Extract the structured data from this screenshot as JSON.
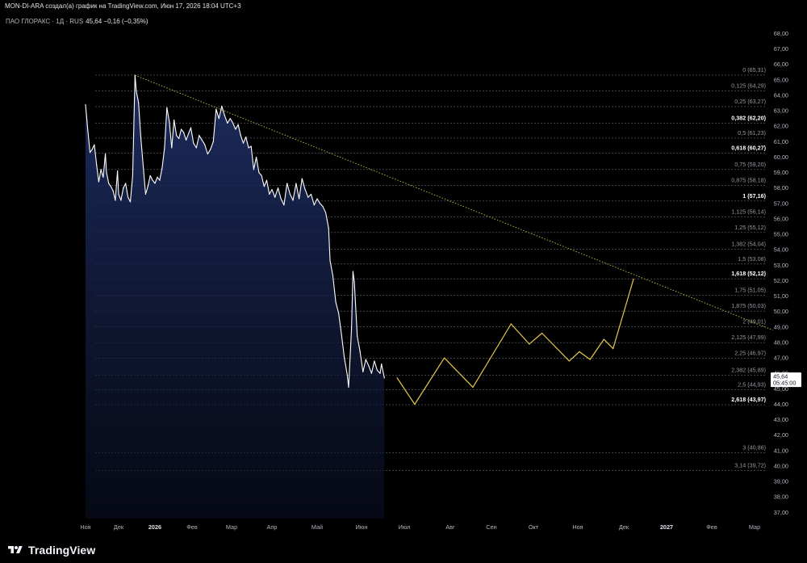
{
  "header": {
    "text": "MON-DI-ARA создал(а) график на TradingView.com, Июн 17, 2026 18:04 UTC+3"
  },
  "legend": {
    "symbol": "ПАО ГЛОРАКС · 1Д · RUS",
    "value": "45,64 −0,16 (−0,35%)"
  },
  "branding": {
    "logo_text": "TradingView",
    "logo_icon": "tradingview-logo-icon"
  },
  "price_marker": {
    "price": "45,64",
    "countdown": "05:45:00",
    "value": 45.64
  },
  "colors": {
    "background": "#000000",
    "price_line": "#ffffff",
    "area_fill_top": "#1f2f66",
    "projection": "#e6c84a",
    "trendline": "#c8c24a",
    "fib_line": "#6a6d78",
    "text": "#d1d4dc"
  },
  "chart_data": {
    "type": "area",
    "title": "ПАО ГЛОРАКС · 1Д · RUS",
    "y_axis": {
      "ylim": [
        36.6,
        68.6
      ],
      "position": "right",
      "ticks": [
        "37,00",
        "38,00",
        "39,00",
        "40,00",
        "41,00",
        "42,00",
        "43,00",
        "44,00",
        "45,00",
        "46,00",
        "47,00",
        "48,00",
        "49,00",
        "50,00",
        "51,00",
        "52,00",
        "53,00",
        "54,00",
        "55,00",
        "56,00",
        "57,00",
        "58,00",
        "59,00",
        "60,00",
        "61,00",
        "62,00",
        "63,00",
        "64,00",
        "65,00",
        "66,00",
        "67,00",
        "68,00"
      ],
      "tick_values": [
        37,
        38,
        39,
        40,
        41,
        42,
        43,
        44,
        45,
        46,
        47,
        48,
        49,
        50,
        51,
        52,
        53,
        54,
        55,
        56,
        57,
        58,
        59,
        60,
        61,
        62,
        63,
        64,
        65,
        66,
        67,
        68
      ]
    },
    "x_axis": {
      "ticks": [
        "Ноя",
        "Дек",
        "2026",
        "Фев",
        "Мар",
        "Апр",
        "Май",
        "Июн",
        "Июл",
        "Авг",
        "Сен",
        "Окт",
        "Ноя",
        "Дек",
        "2027",
        "Фев",
        "Мар"
      ],
      "tick_dates": [
        "2025-11-01",
        "2025-12-01",
        "2026-01-01",
        "2026-02-01",
        "2026-03-01",
        "2026-04-01",
        "2026-05-01",
        "2026-06-01",
        "2026-07-01",
        "2026-08-01",
        "2026-09-01",
        "2026-10-01",
        "2026-11-01",
        "2026-12-01",
        "2027-01-01",
        "2027-02-01",
        "2027-03-01"
      ],
      "bold": [
        "2026",
        "2027"
      ]
    },
    "series": [
      {
        "kind": "price",
        "points": [
          [
            "2025-11-01",
            63.4
          ],
          [
            "2025-11-03",
            61.8
          ],
          [
            "2025-11-05",
            60.3
          ],
          [
            "2025-11-07",
            60.5
          ],
          [
            "2025-11-09",
            60.8
          ],
          [
            "2025-11-11",
            59.5
          ],
          [
            "2025-11-13",
            58.4
          ],
          [
            "2025-11-15",
            59.2
          ],
          [
            "2025-11-17",
            58.7
          ],
          [
            "2025-11-19",
            60.2
          ],
          [
            "2025-11-20",
            59.0
          ],
          [
            "2025-11-22",
            58.3
          ],
          [
            "2025-11-24",
            58.1
          ],
          [
            "2025-11-26",
            57.8
          ],
          [
            "2025-11-28",
            57.2
          ],
          [
            "2025-11-30",
            59.1
          ],
          [
            "2025-12-01",
            57.6
          ],
          [
            "2025-12-03",
            57.2
          ],
          [
            "2025-12-05",
            58.0
          ],
          [
            "2025-12-07",
            58.3
          ],
          [
            "2025-12-09",
            57.4
          ],
          [
            "2025-12-11",
            57.1
          ],
          [
            "2025-12-13",
            58.8
          ],
          [
            "2025-12-15",
            65.3
          ],
          [
            "2025-12-16",
            64.3
          ],
          [
            "2025-12-18",
            63.5
          ],
          [
            "2025-12-20",
            61.2
          ],
          [
            "2025-12-22",
            59.4
          ],
          [
            "2025-12-24",
            57.6
          ],
          [
            "2025-12-26",
            58.1
          ],
          [
            "2025-12-28",
            58.8
          ],
          [
            "2025-12-30",
            58.5
          ],
          [
            "2026-01-01",
            58.3
          ],
          [
            "2026-01-03",
            58.7
          ],
          [
            "2026-01-05",
            58.5
          ],
          [
            "2026-01-07",
            59.3
          ],
          [
            "2026-01-09",
            60.6
          ],
          [
            "2026-01-11",
            63.2
          ],
          [
            "2026-01-13",
            62.3
          ],
          [
            "2026-01-15",
            60.6
          ],
          [
            "2026-01-17",
            62.4
          ],
          [
            "2026-01-19",
            61.4
          ],
          [
            "2026-01-21",
            61.2
          ],
          [
            "2026-01-23",
            61.8
          ],
          [
            "2026-01-25",
            61.6
          ],
          [
            "2026-01-27",
            61.1
          ],
          [
            "2026-01-29",
            61.5
          ],
          [
            "2026-01-31",
            61.9
          ],
          [
            "2026-02-02",
            60.9
          ],
          [
            "2026-02-04",
            60.6
          ],
          [
            "2026-02-06",
            61.4
          ],
          [
            "2026-02-08",
            61.1
          ],
          [
            "2026-02-10",
            60.8
          ],
          [
            "2026-02-12",
            60.2
          ],
          [
            "2026-02-14",
            60.5
          ],
          [
            "2026-02-16",
            61.0
          ],
          [
            "2026-02-18",
            63.1
          ],
          [
            "2026-02-20",
            62.5
          ],
          [
            "2026-02-22",
            63.3
          ],
          [
            "2026-02-24",
            62.7
          ],
          [
            "2026-02-26",
            62.2
          ],
          [
            "2026-02-28",
            62.5
          ],
          [
            "2026-03-02",
            62.2
          ],
          [
            "2026-03-04",
            61.8
          ],
          [
            "2026-03-06",
            62.1
          ],
          [
            "2026-03-08",
            61.4
          ],
          [
            "2026-03-10",
            60.9
          ],
          [
            "2026-03-12",
            61.3
          ],
          [
            "2026-03-14",
            60.6
          ],
          [
            "2026-03-16",
            60.7
          ],
          [
            "2026-03-18",
            59.2
          ],
          [
            "2026-03-20",
            60.0
          ],
          [
            "2026-03-22",
            59.0
          ],
          [
            "2026-03-24",
            58.8
          ],
          [
            "2026-03-26",
            58.1
          ],
          [
            "2026-03-28",
            58.5
          ],
          [
            "2026-03-30",
            57.6
          ],
          [
            "2026-04-01",
            57.9
          ],
          [
            "2026-04-03",
            57.4
          ],
          [
            "2026-04-05",
            58.0
          ],
          [
            "2026-04-07",
            57.3
          ],
          [
            "2026-04-09",
            56.9
          ],
          [
            "2026-04-11",
            58.3
          ],
          [
            "2026-04-13",
            57.6
          ],
          [
            "2026-04-15",
            57.2
          ],
          [
            "2026-04-17",
            58.3
          ],
          [
            "2026-04-19",
            57.3
          ],
          [
            "2026-04-21",
            58.6
          ],
          [
            "2026-04-23",
            57.9
          ],
          [
            "2026-04-25",
            57.4
          ],
          [
            "2026-04-27",
            57.6
          ],
          [
            "2026-04-29",
            56.9
          ],
          [
            "2026-05-01",
            57.3
          ],
          [
            "2026-05-03",
            57.0
          ],
          [
            "2026-05-05",
            56.8
          ],
          [
            "2026-05-07",
            56.4
          ],
          [
            "2026-05-09",
            55.4
          ],
          [
            "2026-05-10",
            53.3
          ],
          [
            "2026-05-12",
            52.3
          ],
          [
            "2026-05-14",
            50.6
          ],
          [
            "2026-05-16",
            49.9
          ],
          [
            "2026-05-18",
            48.5
          ],
          [
            "2026-05-20",
            47.0
          ],
          [
            "2026-05-22",
            45.9
          ],
          [
            "2026-05-23",
            45.1
          ],
          [
            "2026-05-25",
            48.9
          ],
          [
            "2026-05-26",
            52.6
          ],
          [
            "2026-05-27",
            51.9
          ],
          [
            "2026-05-29",
            48.4
          ],
          [
            "2026-05-31",
            47.4
          ],
          [
            "2026-06-02",
            46.1
          ],
          [
            "2026-06-04",
            46.9
          ],
          [
            "2026-06-06",
            46.5
          ],
          [
            "2026-06-08",
            46.0
          ],
          [
            "2026-06-10",
            46.8
          ],
          [
            "2026-06-12",
            46.2
          ],
          [
            "2026-06-14",
            46.0
          ],
          [
            "2026-06-15",
            46.6
          ],
          [
            "2026-06-17",
            45.7
          ]
        ]
      },
      {
        "kind": "projection",
        "points": [
          [
            "2026-06-26",
            45.7
          ],
          [
            "2026-07-08",
            44.0
          ],
          [
            "2026-07-28",
            47.0
          ],
          [
            "2026-08-18",
            45.1
          ],
          [
            "2026-09-15",
            49.2
          ],
          [
            "2026-09-28",
            47.9
          ],
          [
            "2026-10-07",
            48.6
          ],
          [
            "2026-10-26",
            46.8
          ],
          [
            "2026-11-02",
            47.4
          ],
          [
            "2026-11-09",
            46.9
          ],
          [
            "2026-11-18",
            48.2
          ],
          [
            "2026-11-24",
            47.6
          ],
          [
            "2026-12-08",
            52.1
          ]
        ]
      },
      {
        "kind": "trendline",
        "points": [
          [
            "2025-12-15",
            65.3
          ],
          [
            "2027-03-13",
            48.8
          ]
        ]
      }
    ],
    "fibonacci": {
      "levels": [
        {
          "label": "0 (65,31)",
          "price": 65.31,
          "bold": false
        },
        {
          "label": "0,125 (64,29)",
          "price": 64.29,
          "bold": false
        },
        {
          "label": "0,25 (63,27)",
          "price": 63.27,
          "bold": false
        },
        {
          "label": "0,382 (62,20)",
          "price": 62.2,
          "bold": true
        },
        {
          "label": "0,5 (61,23)",
          "price": 61.23,
          "bold": false
        },
        {
          "label": "0,618 (60,27)",
          "price": 60.27,
          "bold": true
        },
        {
          "label": "0,75 (59,20)",
          "price": 59.2,
          "bold": false
        },
        {
          "label": "0,875 (58,18)",
          "price": 58.18,
          "bold": false
        },
        {
          "label": "1 (57,16)",
          "price": 57.16,
          "bold": true
        },
        {
          "label": "1,125 (56,14)",
          "price": 56.14,
          "bold": false
        },
        {
          "label": "1,25 (55,12)",
          "price": 55.12,
          "bold": false
        },
        {
          "label": "1,382 (54,04)",
          "price": 54.04,
          "bold": false
        },
        {
          "label": "1,5 (53,08)",
          "price": 53.08,
          "bold": false
        },
        {
          "label": "1,618 (52,12)",
          "price": 52.12,
          "bold": true
        },
        {
          "label": "1,75 (51,05)",
          "price": 51.05,
          "bold": false
        },
        {
          "label": "1,875 (50,03)",
          "price": 50.03,
          "bold": false
        },
        {
          "label": "2 (49,01)",
          "price": 49.01,
          "bold": false
        },
        {
          "label": "2,125 (47,99)",
          "price": 47.99,
          "bold": false
        },
        {
          "label": "2,25 (46,97)",
          "price": 46.97,
          "bold": false
        },
        {
          "label": "2,382 (45,89)",
          "price": 45.89,
          "bold": false
        },
        {
          "label": "2,5 (44,93)",
          "price": 44.93,
          "bold": false
        },
        {
          "label": "2,618 (43,97)",
          "price": 43.97,
          "bold": true
        },
        {
          "label": "3 (40,86)",
          "price": 40.86,
          "bold": false
        },
        {
          "label": "3,14 (39,72)",
          "price": 39.72,
          "bold": false
        }
      ]
    },
    "grid": false,
    "legend_placement": "top-left"
  }
}
